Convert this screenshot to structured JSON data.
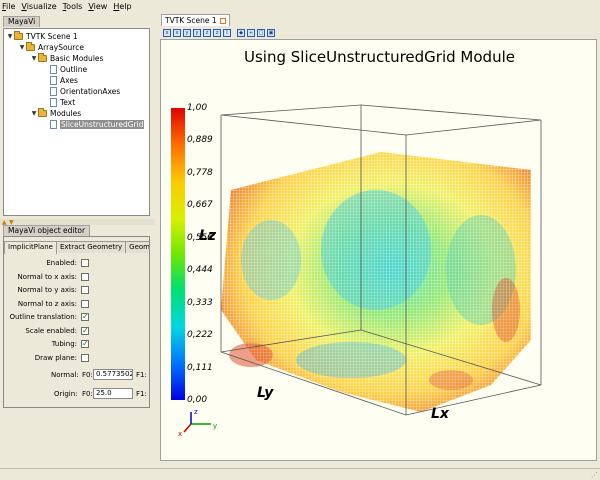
{
  "menu": [
    "File",
    "Visualize",
    "Tools",
    "View",
    "Help"
  ],
  "left_top_tab": "MayaVi",
  "tree": {
    "scene": "TVTK Scene 1",
    "source": "ArraySource",
    "basic_modules": "Basic Modules",
    "outline": "Outline",
    "axes": "Axes",
    "orientation_axes": "OrientationAxes",
    "text": "Text",
    "modules": "Modules",
    "slice": "SliceUnstructuredGrid"
  },
  "editor": {
    "tab": "MayaVi object editor",
    "subtabs": [
      "ImplicitPlane",
      "Extract Geometry",
      "Geometr"
    ],
    "props": [
      {
        "label": "Enabled:",
        "checked": false
      },
      {
        "label": "Normal to x axis:",
        "checked": false
      },
      {
        "label": "Normal to y axis:",
        "checked": false
      },
      {
        "label": "Normal to z axis:",
        "checked": false
      },
      {
        "label": "Outline translation:",
        "checked": true
      },
      {
        "label": "Scale enabled:",
        "checked": true
      },
      {
        "label": "Tubing:",
        "checked": true
      },
      {
        "label": "Draw plane:",
        "checked": false
      }
    ],
    "normal_label": "Normal:",
    "normal_f0_label": "F0:",
    "normal_f0_value": "0.5773502",
    "normal_f1_label": "F1:",
    "origin_label": "Origin:",
    "origin_f0_label": "F0:",
    "origin_f0_value": "25.0",
    "origin_f1_label": "F1:"
  },
  "scene": {
    "tab": "TVTK Scene 1",
    "title": "Using SliceUnstructuredGrid Module",
    "colorbar_ticks": [
      "1,00",
      "0,889",
      "0,778",
      "0,667",
      "0,556",
      "0,444",
      "0,333",
      "0,222",
      "0,111",
      "0,00"
    ],
    "axis_lz": "Lz",
    "axis_ly": "Ly",
    "axis_lx": "Lx",
    "toolbar_icons": [
      "view-x-icon",
      "view-x-icon",
      "view-y-icon",
      "view-y-icon",
      "view-z-icon",
      "view-z-icon",
      "view-iso-icon",
      "parallel-icon",
      "axes-icon",
      "fullscreen-icon",
      "save-icon"
    ]
  },
  "colors": {
    "accent_orange": "#e07820",
    "selection": "#8e8e8e"
  }
}
